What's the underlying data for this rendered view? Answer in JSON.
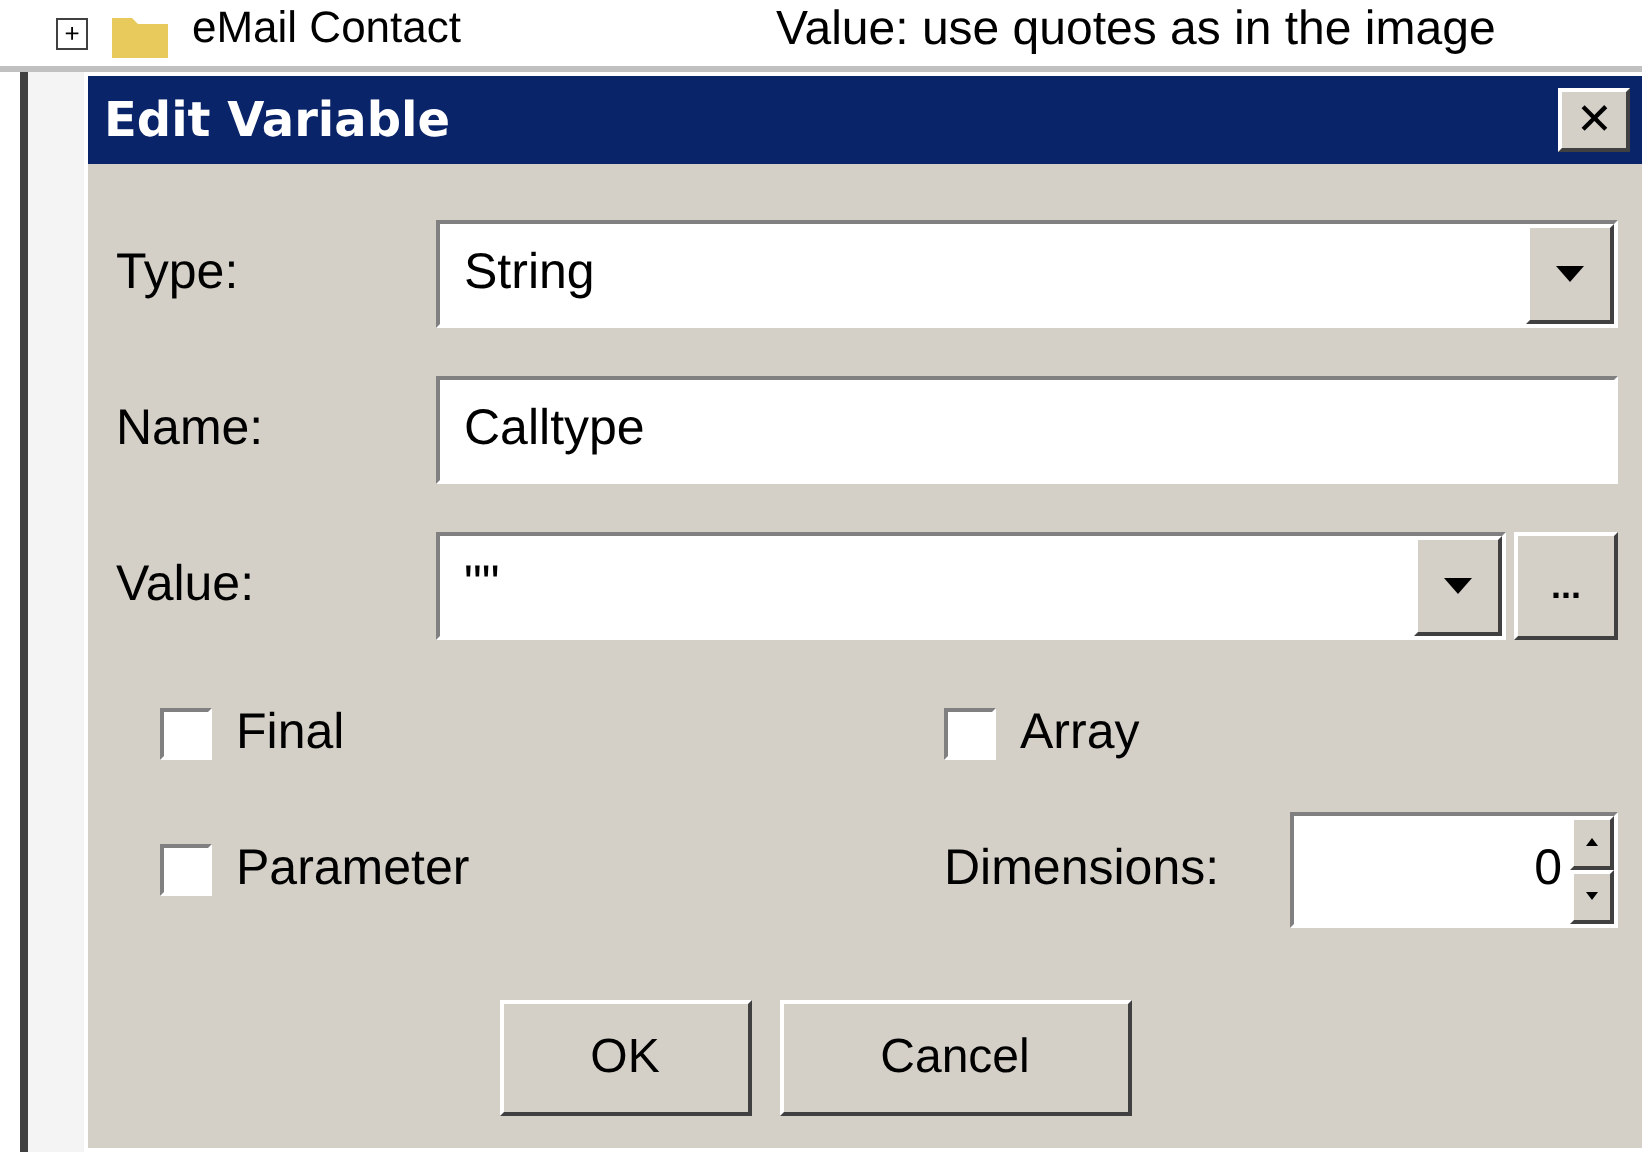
{
  "background": {
    "tree_item": {
      "toggle": "+",
      "label": "eMail Contact"
    },
    "annotation": "Value: use quotes as in the image"
  },
  "dialog": {
    "title": "Edit Variable",
    "close": "✕"
  },
  "fields": [
    {
      "kind": "combo",
      "label": "Type:",
      "value": "String"
    },
    {
      "kind": "text",
      "label": "Name:",
      "value": "Calltype"
    },
    {
      "kind": "combo-browse",
      "label": "Value:",
      "value": "\"\"",
      "browse": "..."
    }
  ],
  "checkboxes": [
    {
      "label": "Final",
      "checked": false
    },
    {
      "label": "Array",
      "checked": false
    },
    {
      "label": "Parameter",
      "checked": false
    }
  ],
  "dimensions": {
    "label": "Dimensions:",
    "value": "0"
  },
  "buttons": [
    "OK",
    "Cancel"
  ]
}
